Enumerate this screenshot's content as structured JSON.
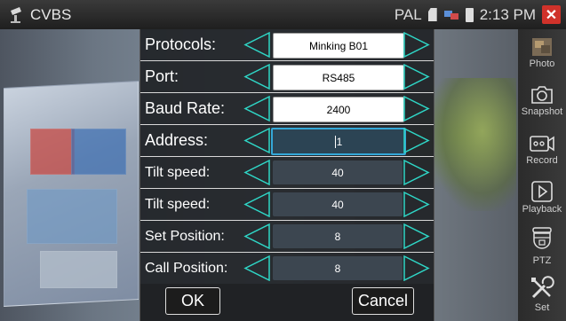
{
  "status_bar": {
    "app_title": "CVBS",
    "video_standard": "PAL",
    "time": "2:13 PM",
    "close_symbol": "✕",
    "icons": [
      "camera-icon",
      "sd-card-icon",
      "network-icon",
      "battery-icon",
      "close-icon"
    ]
  },
  "sidebar": {
    "items": [
      {
        "label": "Photo",
        "icon": "photo-icon"
      },
      {
        "label": "Snapshot",
        "icon": "camera-icon"
      },
      {
        "label": "Record",
        "icon": "record-icon"
      },
      {
        "label": "Playback",
        "icon": "play-icon"
      },
      {
        "label": "PTZ",
        "icon": "ptz-camera-icon"
      },
      {
        "label": "Set",
        "icon": "tools-icon"
      }
    ]
  },
  "ptz_dialog": {
    "rows": [
      {
        "label": "Protocols:",
        "value": "Minking B01",
        "style": "white"
      },
      {
        "label": "Port:",
        "value": "RS485",
        "style": "white"
      },
      {
        "label": "Baud Rate:",
        "value": "2400",
        "style": "white"
      },
      {
        "label": "Address:",
        "value": "1",
        "style": "active"
      },
      {
        "label": "Tilt speed:",
        "value": "40",
        "style": "dark"
      },
      {
        "label": "Tilt speed:",
        "value": "40",
        "style": "dark"
      },
      {
        "label": "Set Position:",
        "value": "8",
        "style": "dark"
      },
      {
        "label": "Call Position:",
        "value": "8",
        "style": "dark"
      }
    ],
    "ok_label": "OK",
    "cancel_label": "Cancel"
  },
  "colors": {
    "accent": "#34a8d8",
    "arrow_outline": "#2fd6c6",
    "close_red": "#d0322a"
  }
}
